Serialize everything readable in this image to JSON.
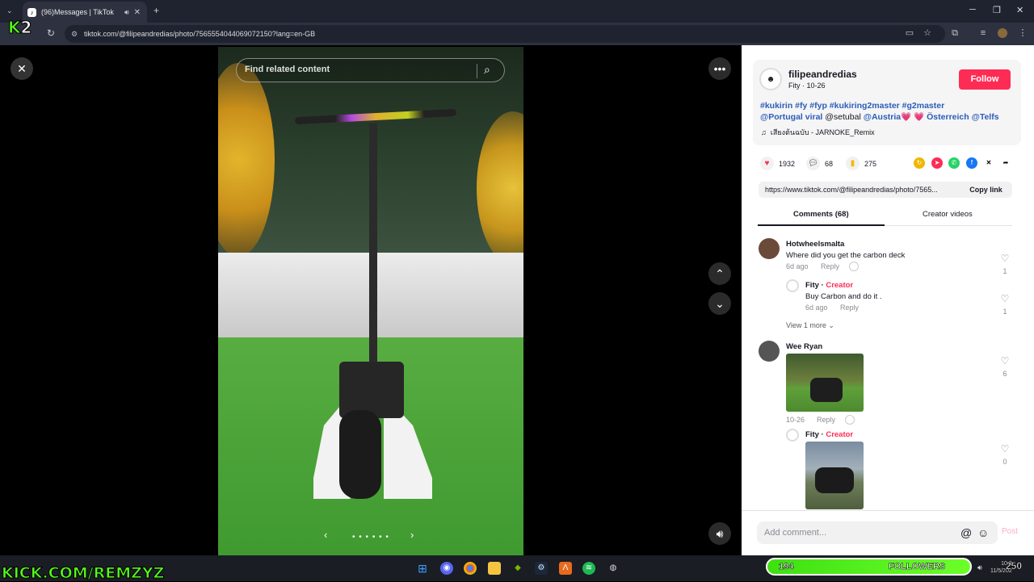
{
  "browser": {
    "tab_title": "(96)Messages | TikTok",
    "url": "tiktok.com/@filipeandredias/photo/7565554044069072150?lang=en-GB"
  },
  "viewer": {
    "search_placeholder": "Find related content",
    "carousel_dots": "• • • • • •"
  },
  "post": {
    "username": "filipeandredias",
    "subtitle": "Fity · 10-26",
    "follow_label": "Follow",
    "hashtags_line1": "#kukirin #fy #fyp #kukiring2master #g2master",
    "mention_portugal": "@Portugal viral",
    "mention_setubal": "@setubal",
    "mention_austria": "@Austria",
    "heart1": "💗",
    "heart2": "💗",
    "mention_osterreich": "Österreich",
    "mention_telfs": "@Telfs",
    "music": "เสียงต้นฉบับ - JARNOKE_Remix",
    "likes": "1932",
    "comments": "68",
    "saves": "275",
    "share_link": "https://www.tiktok.com/@filipeandredias/photo/7565...",
    "copy_label": "Copy link"
  },
  "tabs": {
    "comments": "Comments (68)",
    "creator_videos": "Creator videos"
  },
  "comments": [
    {
      "name": "Hotwheelsmalta",
      "text": "Where did you get the carbon deck",
      "time": "6d ago",
      "reply": "Reply",
      "likes": "1"
    },
    {
      "name": "Fity",
      "badge": "Creator",
      "text": "Buy Carbon and do it .",
      "time": "6d ago",
      "reply": "Reply",
      "likes": "1"
    },
    {
      "view_more": "View 1 more"
    },
    {
      "name": "Wee Ryan",
      "time": "10-26",
      "reply": "Reply",
      "likes": "6"
    },
    {
      "name": "Fity",
      "badge": "Creator",
      "likes": "0"
    }
  ],
  "add_comment": {
    "placeholder": "Add comment...",
    "post_label": "Post"
  },
  "overlay": {
    "kick_url": "KICK.COM/REMZYZ",
    "followers_count": "194",
    "followers_label": "FOLLOWERS",
    "viewer_count": "250",
    "clock_time": "10:3",
    "clock_date": "11/5/202"
  },
  "colors": {
    "accent": "#fe2c55",
    "kick_green": "#53fc18",
    "link_blue": "#2b5db9"
  }
}
